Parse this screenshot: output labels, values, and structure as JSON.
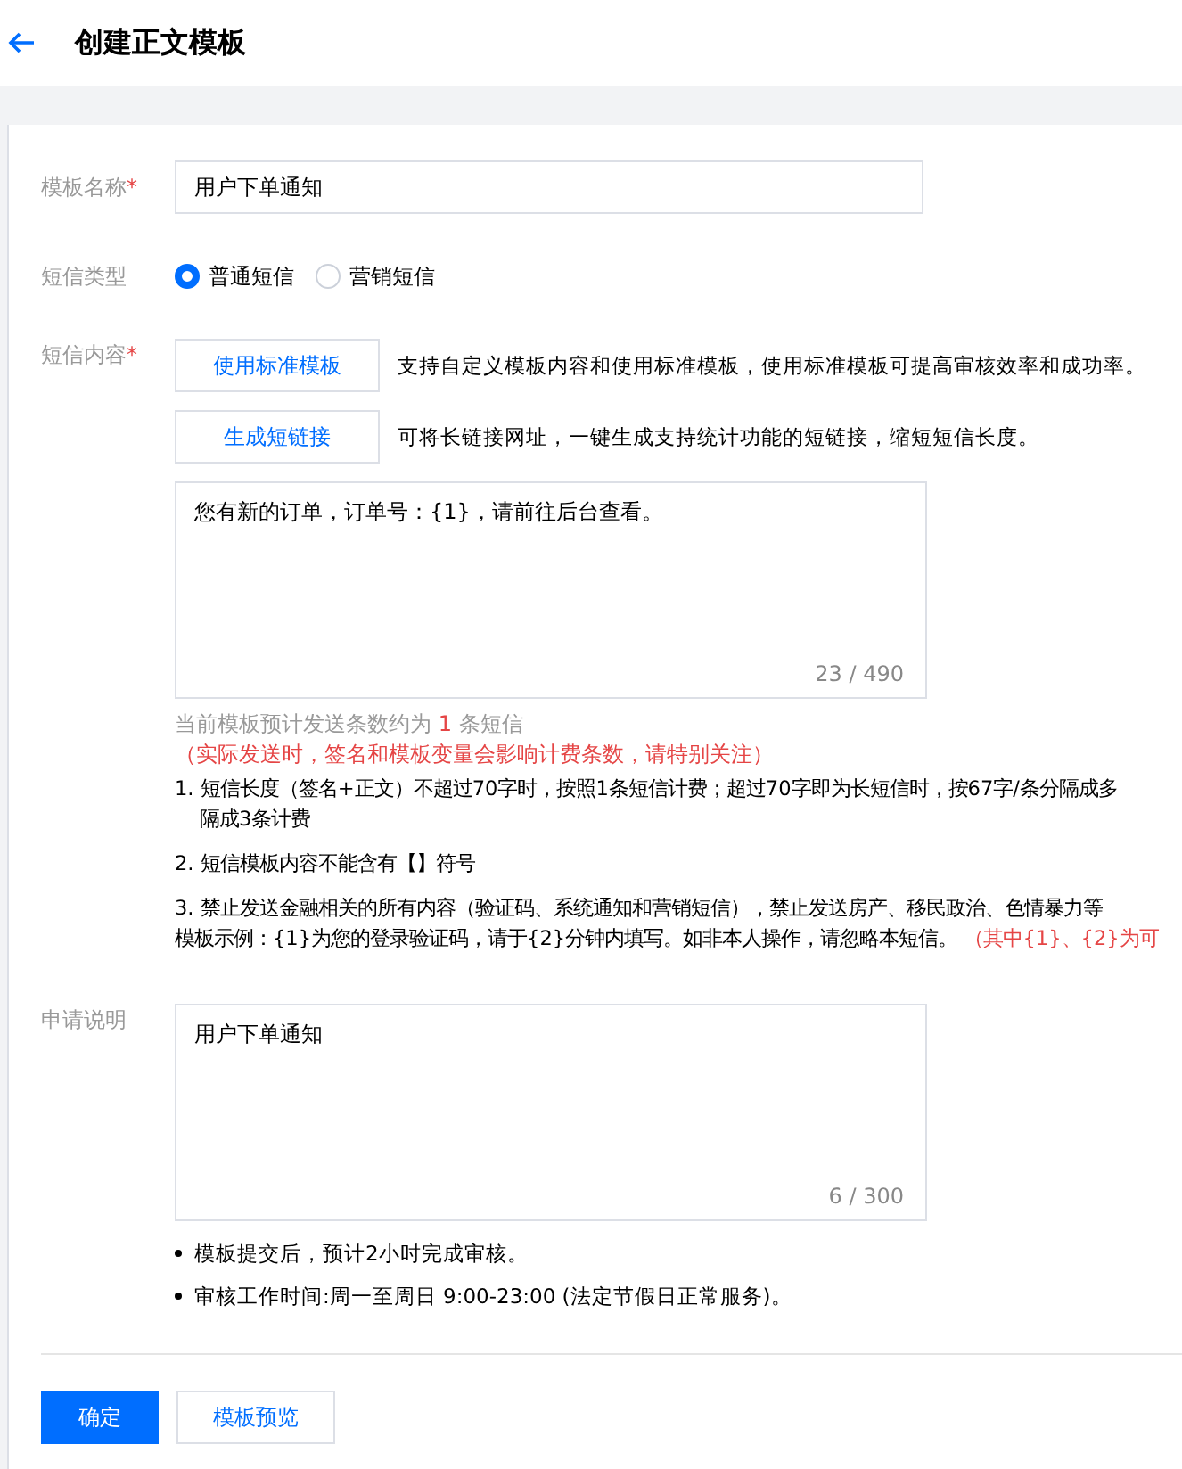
{
  "header": {
    "title": "创建正文模板"
  },
  "name_field": {
    "label": "模板名称",
    "required_mark": "*",
    "value": "用户下单通知"
  },
  "type_field": {
    "label": "短信类型",
    "options": [
      {
        "label": "普通短信",
        "selected": true
      },
      {
        "label": "营销短信",
        "selected": false
      }
    ]
  },
  "content_field": {
    "label": "短信内容",
    "required_mark": "*",
    "actions": [
      {
        "button": "使用标准模板",
        "hint": "支持自定义模板内容和使用标准模板，使用标准模板可提高审核效率和成功率。"
      },
      {
        "button": "生成短链接",
        "hint": "可将长链接网址，一键生成支持统计功能的短链接，缩短短信长度。"
      }
    ],
    "value": "您有新的订单，订单号：{1}，请前往后台查看。",
    "counter": "23 / 490",
    "estimate_prefix": "当前模板预计发送条数约为",
    "estimate_count": "1",
    "estimate_suffix": "条短信",
    "warning": "（实际发送时，签名和模板变量会影响计费条数，请特别关注）",
    "rules": [
      {
        "lines": [
          "1. 短信长度（签名+正文）不超过70字时，按照1条短信计费；超过70字即为长短信时，按67字/条分隔成多",
          "隔成3条计费"
        ]
      },
      {
        "lines": [
          "2. 短信模板内容不能含有【】符号"
        ]
      },
      {
        "lines": [
          "3. 禁止发送金融相关的所有内容（验证码、系统通知和营销短信），禁止发送房产、移民政治、色情暴力等",
          "模板示例：{1}为您的登录验证码，请于{2}分钟内填写。如非本人操作，请忽略本短信。"
        ],
        "note": "（其中{1}、{2}为可"
      }
    ]
  },
  "remark_field": {
    "label": "申请说明",
    "value": "用户下单通知",
    "counter": "6 / 300",
    "tips": [
      "模板提交后，预计2小时完成审核。",
      "审核工作时间:周一至周日 9:00-23:00 (法定节假日正常服务)。"
    ]
  },
  "buttons": [
    {
      "label": "确定",
      "kind": "primary"
    },
    {
      "label": "模板预览",
      "kind": "default"
    }
  ]
}
